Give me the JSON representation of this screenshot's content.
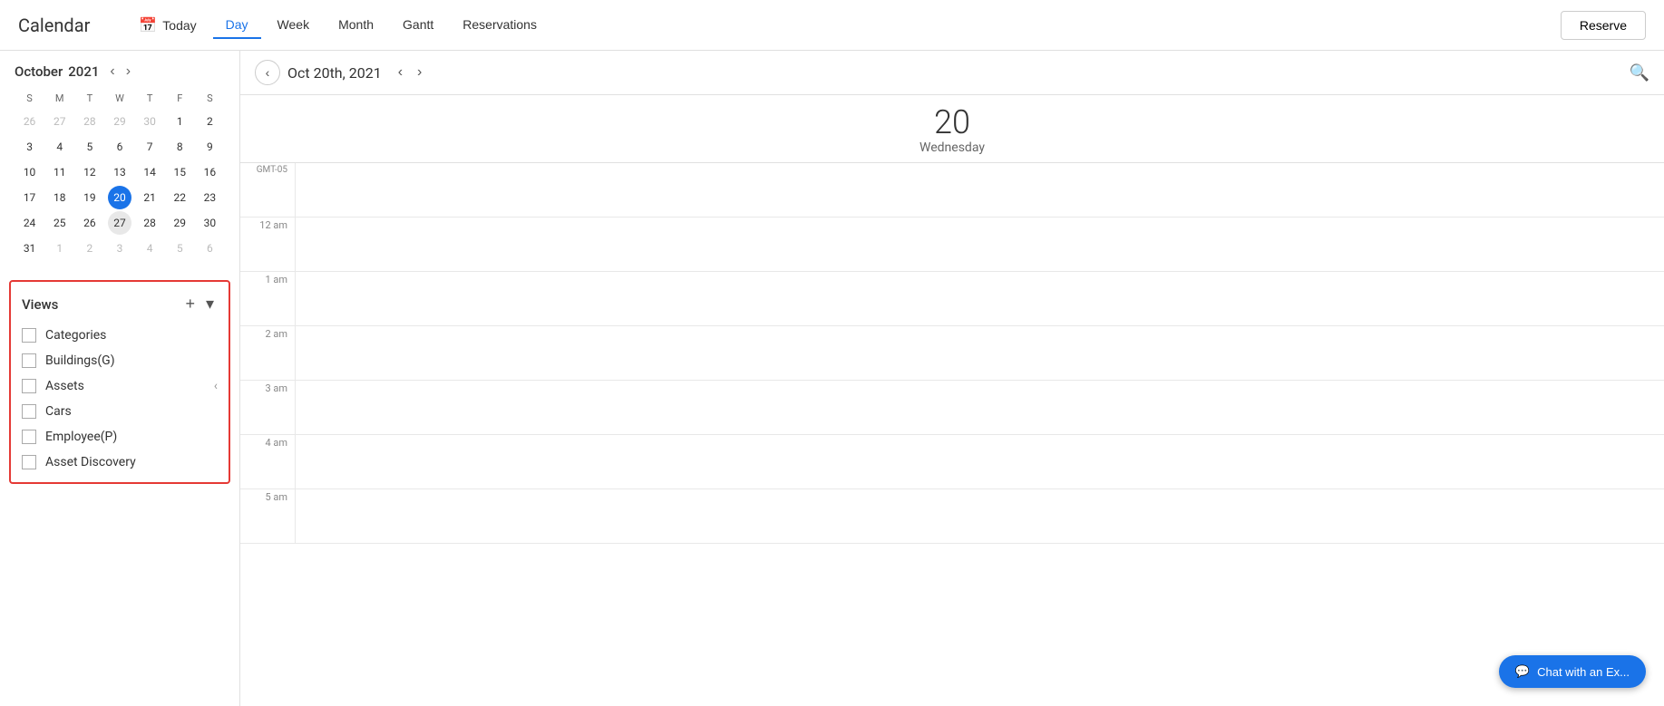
{
  "header": {
    "title": "Calendar",
    "today_label": "Today",
    "tabs": [
      "Day",
      "Week",
      "Month",
      "Gantt",
      "Reservations"
    ],
    "active_tab": "Day",
    "reserve_label": "Reserve"
  },
  "mini_calendar": {
    "month": "October",
    "year": "2021",
    "days_of_week": [
      "S",
      "M",
      "T",
      "W",
      "T",
      "F",
      "S"
    ],
    "weeks": [
      [
        {
          "day": "26",
          "type": "other"
        },
        {
          "day": "27",
          "type": "other"
        },
        {
          "day": "28",
          "type": "other"
        },
        {
          "day": "29",
          "type": "other"
        },
        {
          "day": "30",
          "type": "other"
        },
        {
          "day": "1",
          "type": "normal"
        },
        {
          "day": "2",
          "type": "normal"
        }
      ],
      [
        {
          "day": "3",
          "type": "normal"
        },
        {
          "day": "4",
          "type": "normal"
        },
        {
          "day": "5",
          "type": "normal"
        },
        {
          "day": "6",
          "type": "normal"
        },
        {
          "day": "7",
          "type": "normal"
        },
        {
          "day": "8",
          "type": "normal"
        },
        {
          "day": "9",
          "type": "normal"
        }
      ],
      [
        {
          "day": "10",
          "type": "normal"
        },
        {
          "day": "11",
          "type": "normal"
        },
        {
          "day": "12",
          "type": "normal"
        },
        {
          "day": "13",
          "type": "normal"
        },
        {
          "day": "14",
          "type": "normal"
        },
        {
          "day": "15",
          "type": "normal"
        },
        {
          "day": "16",
          "type": "normal"
        }
      ],
      [
        {
          "day": "17",
          "type": "normal"
        },
        {
          "day": "18",
          "type": "normal"
        },
        {
          "day": "19",
          "type": "normal"
        },
        {
          "day": "20",
          "type": "today"
        },
        {
          "day": "21",
          "type": "normal"
        },
        {
          "day": "22",
          "type": "normal"
        },
        {
          "day": "23",
          "type": "normal"
        }
      ],
      [
        {
          "day": "24",
          "type": "normal"
        },
        {
          "day": "25",
          "type": "normal"
        },
        {
          "day": "26",
          "type": "normal"
        },
        {
          "day": "27",
          "type": "selected-week"
        },
        {
          "day": "28",
          "type": "normal"
        },
        {
          "day": "29",
          "type": "normal"
        },
        {
          "day": "30",
          "type": "normal"
        }
      ],
      [
        {
          "day": "31",
          "type": "normal"
        },
        {
          "day": "1",
          "type": "other"
        },
        {
          "day": "2",
          "type": "other"
        },
        {
          "day": "3",
          "type": "other"
        },
        {
          "day": "4",
          "type": "other"
        },
        {
          "day": "5",
          "type": "other"
        },
        {
          "day": "6",
          "type": "other"
        }
      ]
    ]
  },
  "views": {
    "title": "Views",
    "add_label": "+",
    "collapse_label": "▾",
    "items": [
      {
        "label": "Categories",
        "checked": false
      },
      {
        "label": "Buildings(G)",
        "checked": false
      },
      {
        "label": "Assets",
        "checked": false,
        "has_collapse": true
      },
      {
        "label": "Cars",
        "checked": false
      },
      {
        "label": "Employee(P)",
        "checked": false
      },
      {
        "label": "Asset Discovery",
        "checked": false
      }
    ]
  },
  "day_view": {
    "date_title": "Oct 20th, 2021",
    "day_number": "20",
    "day_name": "Wednesday",
    "gmt_label": "GMT-05",
    "time_slots": [
      "12 am",
      "1 am",
      "2 am",
      "3 am",
      "4 am",
      "5 am"
    ]
  },
  "chat": {
    "label": "Chat with an Ex..."
  }
}
